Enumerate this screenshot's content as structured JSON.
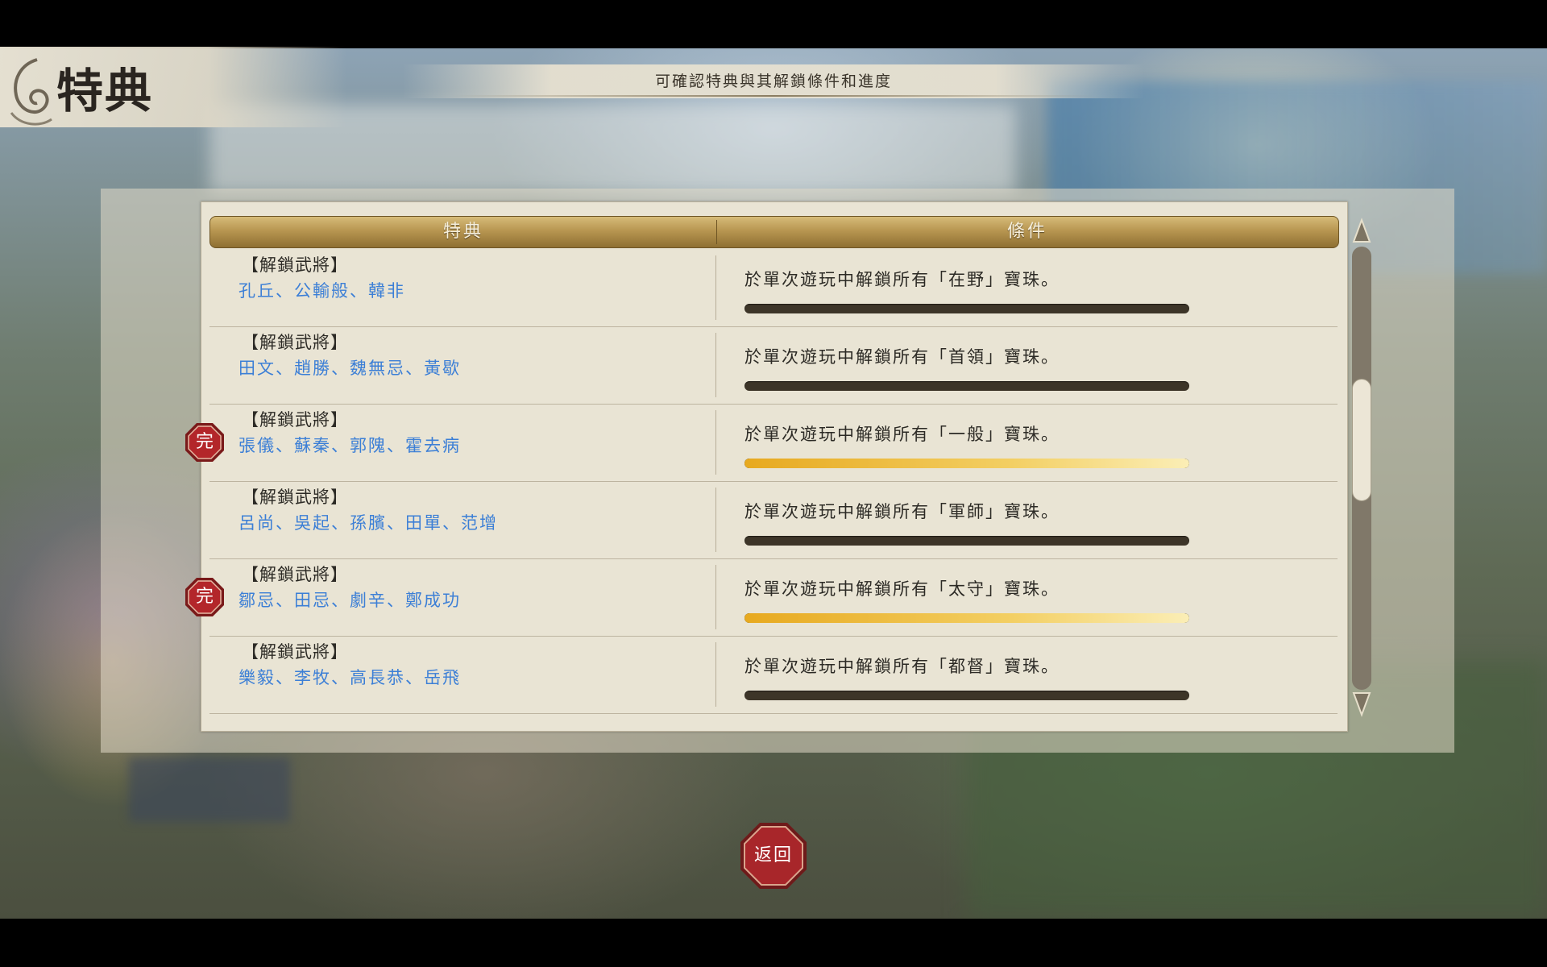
{
  "header": {
    "title": "特典",
    "subtitle": "可確認特典與其解鎖條件和進度"
  },
  "table": {
    "col_reward": "特典",
    "col_condition": "條件",
    "rows": [
      {
        "category": "【解鎖武將】",
        "names": "孔丘、公輸般、韓非",
        "condition": "於單次遊玩中解鎖所有「在野」寶珠。",
        "progress": 0,
        "completed": false
      },
      {
        "category": "【解鎖武將】",
        "names": "田文、趙勝、魏無忌、黃歇",
        "condition": "於單次遊玩中解鎖所有「首領」寶珠。",
        "progress": 0,
        "completed": false
      },
      {
        "category": "【解鎖武將】",
        "names": "張儀、蘇秦、郭隗、霍去病",
        "condition": "於單次遊玩中解鎖所有「一般」寶珠。",
        "progress": 1,
        "completed": true
      },
      {
        "category": "【解鎖武將】",
        "names": "呂尚、吳起、孫臏、田單、范增",
        "condition": "於單次遊玩中解鎖所有「軍師」寶珠。",
        "progress": 0,
        "completed": false
      },
      {
        "category": "【解鎖武將】",
        "names": "鄒忌、田忌、劇辛、鄭成功",
        "condition": "於單次遊玩中解鎖所有「太守」寶珠。",
        "progress": 1,
        "completed": true
      },
      {
        "category": "【解鎖武將】",
        "names": "樂毅、李牧、高長恭、岳飛",
        "condition": "於單次遊玩中解鎖所有「都督」寶珠。",
        "progress": 0,
        "completed": false
      }
    ]
  },
  "badge_label": "完",
  "back_button": "返回",
  "colors": {
    "name_link": "#3c7fd6",
    "progress_fill": "#f0c445",
    "progress_empty": "#3d3528",
    "badge_red": "#b3262a",
    "header_gold": "#b89651"
  },
  "icons": {
    "scroll_up": "triangle-up-icon",
    "scroll_down": "triangle-down-icon",
    "badge": "octagon-badge-icon"
  }
}
